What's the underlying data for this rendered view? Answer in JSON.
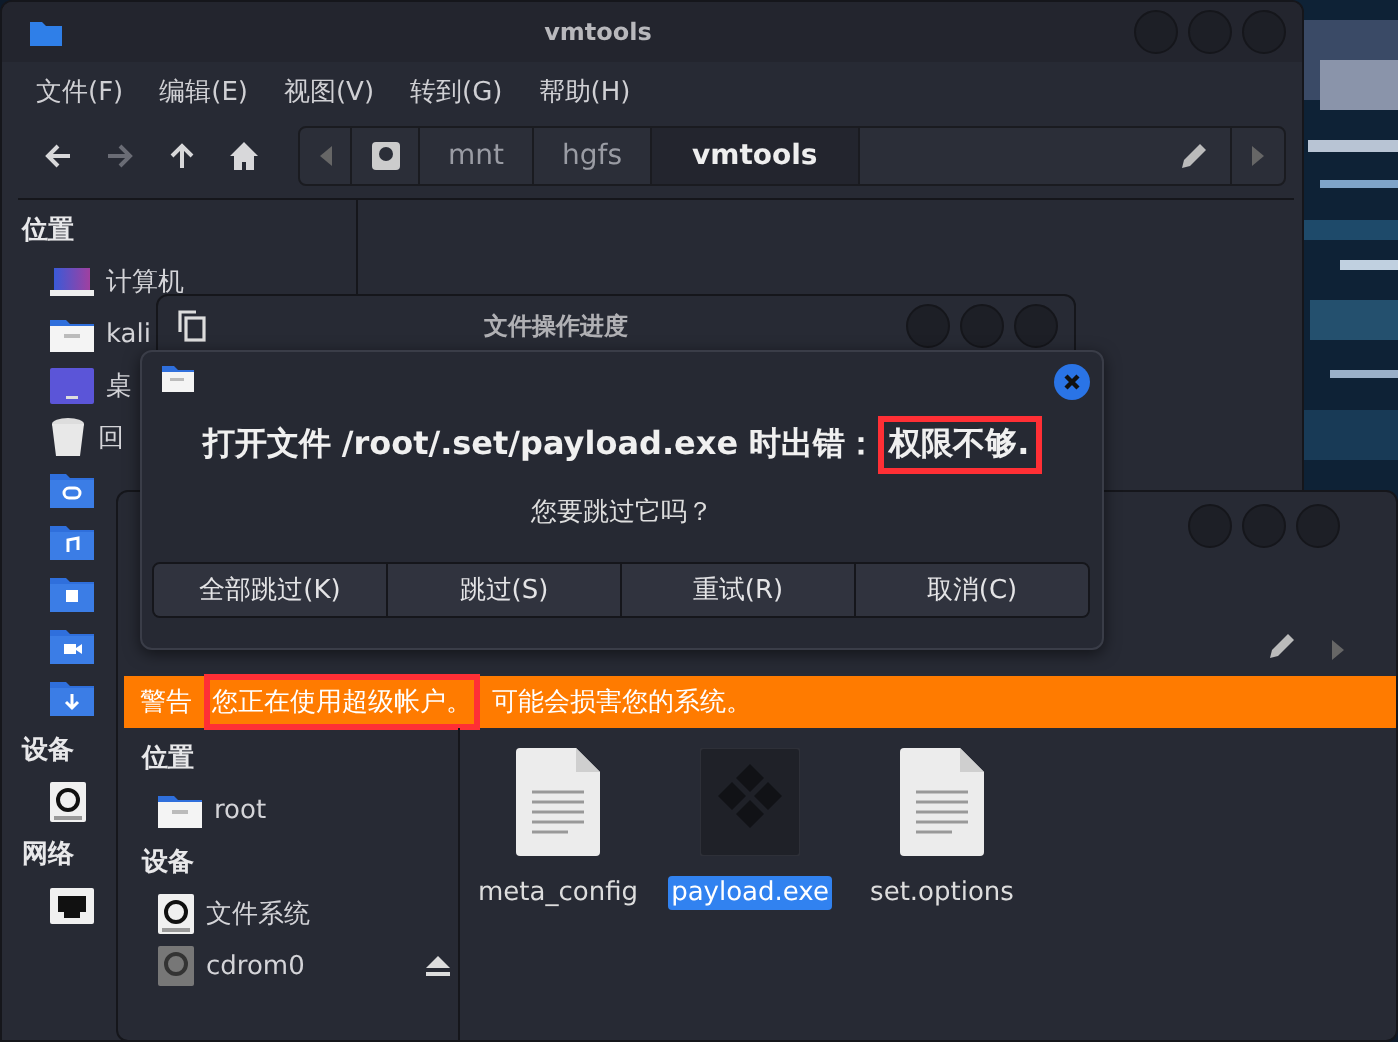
{
  "back_window": {
    "title": "vmtools",
    "menu": [
      "文件(F)",
      "编辑(E)",
      "视图(V)",
      "转到(G)",
      "帮助(H)"
    ],
    "nav": [
      {
        "kind": "back",
        "disabled": false
      },
      {
        "kind": "forward",
        "disabled": true
      },
      {
        "kind": "up",
        "disabled": false
      },
      {
        "kind": "home",
        "disabled": false
      }
    ],
    "path": [
      {
        "label": "mnt",
        "selected": false
      },
      {
        "label": "hgfs",
        "selected": false
      },
      {
        "label": "vmtools",
        "selected": true
      }
    ],
    "sidebar": {
      "places_heading": "位置",
      "places": [
        {
          "kind": "computer",
          "label": "计算机"
        },
        {
          "kind": "home",
          "label": "kali"
        },
        {
          "kind": "desktop",
          "label": "桌"
        },
        {
          "kind": "trash",
          "label": "回"
        },
        {
          "kind": "documents"
        },
        {
          "kind": "music"
        },
        {
          "kind": "pictures"
        },
        {
          "kind": "videos"
        },
        {
          "kind": "downloads"
        }
      ],
      "devices_heading": "设备",
      "devices": [
        {
          "kind": "drive"
        }
      ],
      "network_heading": "网络",
      "network": [
        {
          "kind": "network"
        }
      ]
    }
  },
  "progress_window": {
    "title": "文件操作进度"
  },
  "error_dialog": {
    "message": [
      {
        "text": "打开文件 /root/.set/payload.exe 时出错：",
        "highlighted": false
      },
      {
        "text": "权限不够.",
        "highlighted": true
      }
    ],
    "question": "您要跳过它吗？",
    "buttons": [
      "全部跳过(K)",
      "跳过(S)",
      "重试(R)",
      "取消(C)"
    ]
  },
  "root_window": {
    "warning": [
      {
        "text": "警告",
        "highlighted": false
      },
      {
        "text": "您正在使用超级帐户。",
        "highlighted": true
      },
      {
        "text": "可能会损害您的系统。",
        "highlighted": false
      }
    ],
    "sidebar": {
      "places_heading": "位置",
      "places": [
        {
          "kind": "home",
          "label": "root"
        }
      ],
      "devices_heading": "设备",
      "devices": [
        {
          "kind": "drive",
          "label": "文件系统",
          "ejectable": false
        },
        {
          "kind": "optical",
          "label": "cdrom0",
          "ejectable": true
        }
      ]
    },
    "files": [
      {
        "name": "meta_config",
        "kind": "text",
        "selected": false
      },
      {
        "name": "payload.exe",
        "kind": "executable",
        "selected": true
      },
      {
        "name": "set.options",
        "kind": "text",
        "selected": false
      }
    ]
  }
}
